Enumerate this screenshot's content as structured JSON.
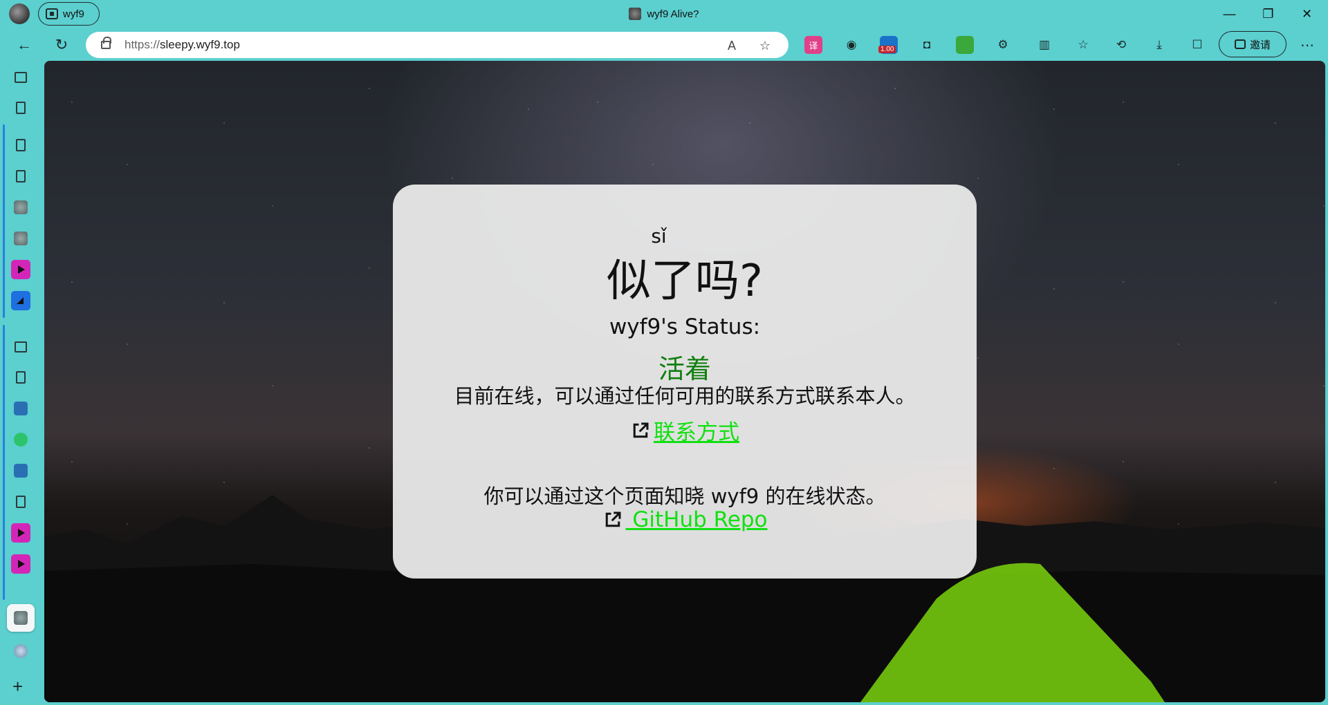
{
  "browser": {
    "profile_name": "wyf9",
    "tab_title": "wyf9 Alive?",
    "url_scheme": "https://",
    "url_host": "sleepy.wyf9.top",
    "invite_label": "邀请",
    "zoom_badge": "1.00",
    "window_controls": [
      "minimize-icon",
      "restore-icon",
      "close-icon"
    ]
  },
  "page": {
    "pinyin": "sǐ",
    "title": "似了吗?",
    "status_label": "wyf9's Status:",
    "status_value": "活着",
    "status_color": "#0f7f0f",
    "status_description": "目前在线，可以通过任何可用的联系方式联系本人。",
    "contact_link": "联系方式",
    "page_description": "你可以通过这个页面知晓 wyf9 的在线状态。",
    "repo_link": " GitHub Repo",
    "link_color": "#10e010"
  }
}
